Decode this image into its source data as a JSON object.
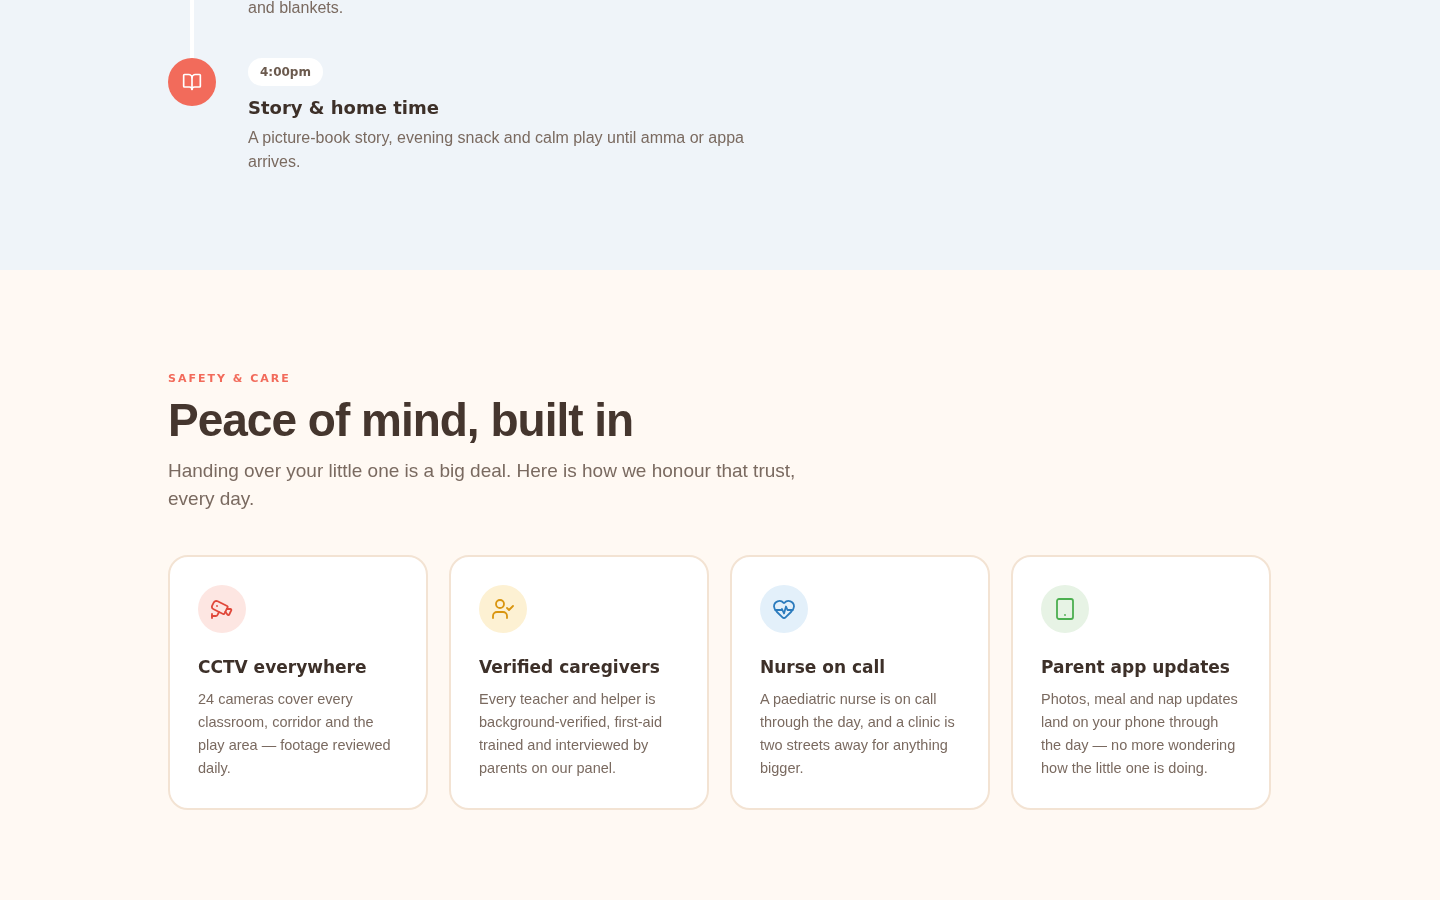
{
  "timeline": {
    "items": [
      {
        "description": "and blankets."
      },
      {
        "time": "4:00pm",
        "title": "Story & home time",
        "description": "A picture-book story, evening snack and calm play until amma or appa arrives."
      }
    ]
  },
  "safety": {
    "eyebrow": "SAFETY & CARE",
    "heading": "Peace of mind, built in",
    "intro": "Handing over your little one is a big deal. Here is how we honour that trust, every day.",
    "features": [
      {
        "kind": "camera",
        "title": "CCTV everywhere",
        "description": "24 cameras cover every classroom, corridor and the play area — footage reviewed daily."
      },
      {
        "kind": "person",
        "title": "Verified caregivers",
        "description": "Every teacher and helper is background-verified, first-aid trained and interviewed by parents on our panel."
      },
      {
        "kind": "heart",
        "title": "Nurse on call",
        "description": "A paediatric nurse is on call through the day, and a clinic is two streets away for anything bigger."
      },
      {
        "kind": "tablet",
        "title": "Parent app updates",
        "description": "Photos, meal and nap updates land on your phone through the day — no more wondering how the little one is doing."
      }
    ]
  }
}
